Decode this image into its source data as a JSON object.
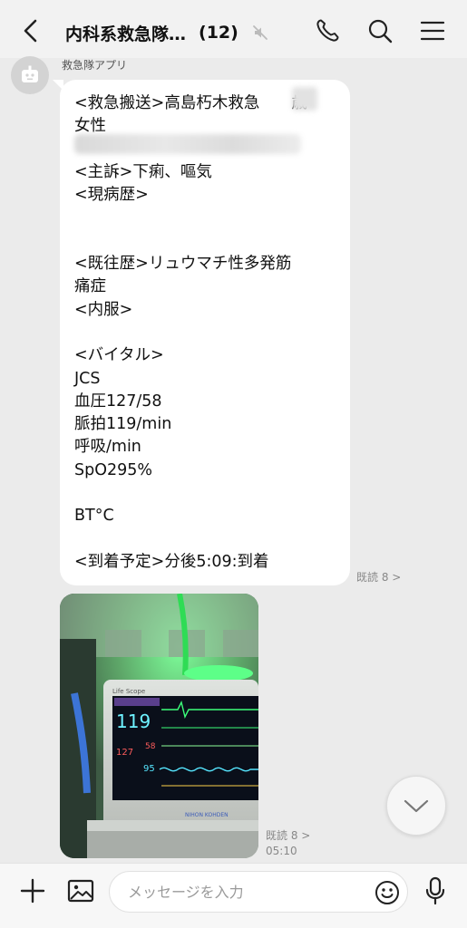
{
  "header": {
    "title": "内科系救急隊…",
    "member_count": "(12)",
    "back_icon": "chevron-left-icon",
    "mute_icon": "muted-speaker-icon",
    "call_icon": "phone-icon",
    "search_icon": "search-icon",
    "menu_icon": "hamburger-menu-icon"
  },
  "message1": {
    "sender": "救急隊アプリ",
    "text": "<救急搬送>高島朽木救急　　歳\n女性\n\n<主訴>下痢、嘔気\n<現病歴>\n\n\n<既往歴>リュウマチ性多発筋\n痛症\n<内服>\n\n<バイタル>\nJCS\n血圧127/58\n脈拍119/min\n呼吸/min\nSpO295%\n\nBT°C\n\n<到着予定>分後5:09:到着",
    "read_status": "既読 8 >"
  },
  "message2": {
    "monitor_brand": "Life Scope",
    "monitor_maker": "NIHON KOHDEN",
    "hr_value": "119",
    "bp_value": "127",
    "bp_dia": "58",
    "spo2_value": "95",
    "read_status": "既読 8 >",
    "time": "05:10"
  },
  "composer": {
    "placeholder": "メッセージを入力",
    "value": ""
  },
  "colors": {
    "background": "#ebebeb",
    "bubble": "#ffffff",
    "monitor_green": "#3cff7a"
  }
}
